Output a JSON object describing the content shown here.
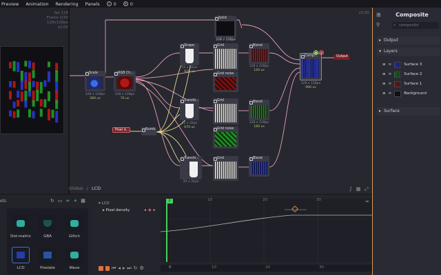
{
  "menu": {
    "items": [
      "Preview",
      "Animation",
      "Rendering",
      "Panels"
    ],
    "notifications": {
      "warnings": "0",
      "errors": "0"
    }
  },
  "graph": {
    "info": {
      "fps": "fps 118",
      "frame": "Frame 1/30",
      "size": "128x128px",
      "scale": "x2.00"
    },
    "zoom": "x0.65",
    "nodes": {
      "solid": "Solid",
      "scale": "Scale",
      "rgb": "RGB Ch...",
      "shape": "Shape",
      "grid_top": "Grid",
      "grid_mid": "Grid",
      "grid_bot": "Grid",
      "grid_noise_a": "Grid noise",
      "grid_noise_b": "Grid noise",
      "blend_a": "Blend",
      "blend_b": "Blend",
      "blend_c": "Blend",
      "transform_a": "Transfo...",
      "transform_b": "Transfo...",
      "number": "Numb...",
      "composite": "Comp...",
      "pixel_density": "Pixel d...",
      "output": "Output"
    },
    "meta": {
      "solid": "128 x 128px",
      "scale": "128 x 128px",
      "scale_t": "280 us",
      "rgb": "128 x 128px",
      "rgb_t": "70 us",
      "shape": "32 x 32px",
      "shape_t": "620 us",
      "grid_top": "128 x 128px",
      "blend_a": "128 x 128px",
      "blend_a_t": "140 us",
      "transform_a": "32 x 32px",
      "transform_a_t": "670 us",
      "blend_b": "128 x 128px",
      "blend_b_t": "180 us",
      "composite": "128 x 128px",
      "composite_t": "990 us",
      "transform_b": "32 x 32px"
    },
    "colors": {
      "accent_green": "#a6d46e",
      "wire_pink": "#e8a0b8",
      "wire_yellow": "#e6d98a"
    }
  },
  "breadcrumb": {
    "root": "Global",
    "current": "LCD"
  },
  "inspector": {
    "title": "Composite",
    "search_placeholder": "composite",
    "sections": {
      "output": "Output",
      "layers": "Layers",
      "surface": "Surface"
    },
    "layers": [
      "Surface 3",
      "Surface 2",
      "Surface 1",
      "Background"
    ]
  },
  "presets": {
    "header": "ets",
    "items": [
      {
        "label": "Dot-matrix",
        "icon": "dot-matrix-icon"
      },
      {
        "label": "GBA",
        "icon": "shield-icon"
      },
      {
        "label": "Glitch",
        "icon": "glitch-icon"
      },
      {
        "label": "LCD",
        "icon": "lcd-icon"
      },
      {
        "label": "Pixelate",
        "icon": "pixelate-icon"
      },
      {
        "label": "Wave",
        "icon": "wave-icon"
      }
    ]
  },
  "timeline": {
    "group": "LCD",
    "property": "Pixel density",
    "frame_marker": "2",
    "ruler_top": [
      "10",
      "20",
      "30"
    ],
    "ruler_bottom": [
      "0",
      "10",
      "20",
      "30"
    ]
  }
}
